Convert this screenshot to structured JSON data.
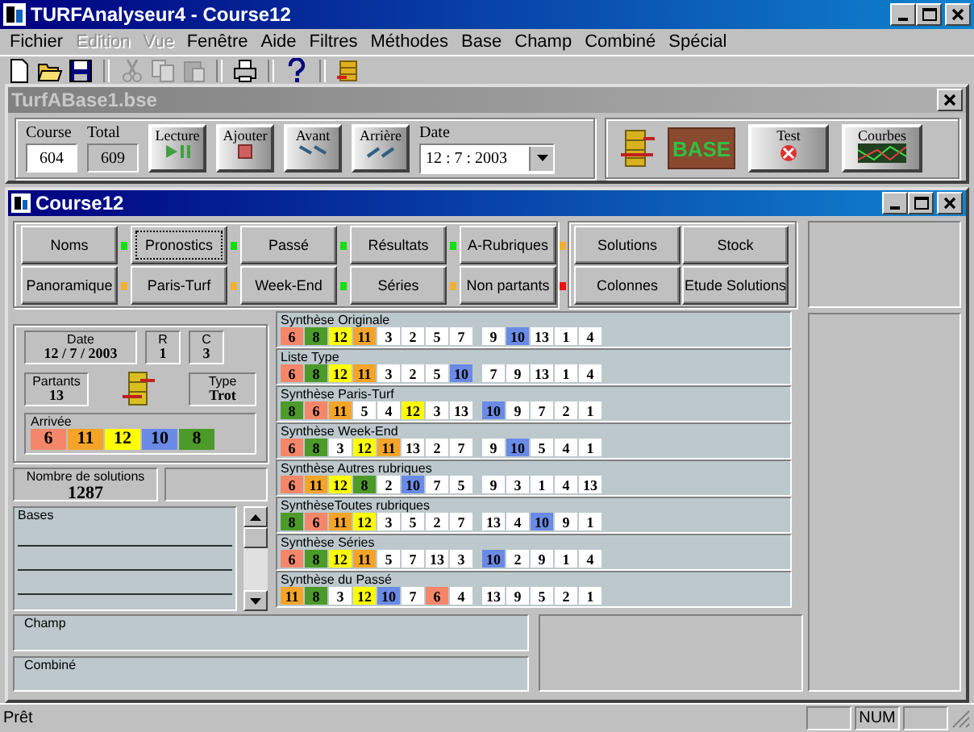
{
  "app_window": {
    "title": "TURFAnalyseur4 - Course12"
  },
  "menu": [
    {
      "label": "Fichier",
      "disabled": false
    },
    {
      "label": "Edition",
      "disabled": true
    },
    {
      "label": "Vue",
      "disabled": true
    },
    {
      "label": "Fenêtre",
      "disabled": false
    },
    {
      "label": "Aide",
      "disabled": false
    },
    {
      "label": "Filtres",
      "disabled": false
    },
    {
      "label": "Méthodes",
      "disabled": false
    },
    {
      "label": "Base",
      "disabled": false
    },
    {
      "label": "Champ",
      "disabled": false
    },
    {
      "label": "Combiné",
      "disabled": false
    },
    {
      "label": "Spécial",
      "disabled": false
    }
  ],
  "toolbar_groups": [
    [
      {
        "kind": "new",
        "disabled": false
      },
      {
        "kind": "open",
        "disabled": false
      },
      {
        "kind": "save",
        "disabled": false
      }
    ],
    [
      {
        "kind": "cut",
        "disabled": true
      },
      {
        "kind": "copy",
        "disabled": true
      },
      {
        "kind": "paste",
        "disabled": true
      }
    ],
    [
      {
        "kind": "print",
        "disabled": false
      }
    ],
    [
      {
        "kind": "help",
        "disabled": false
      }
    ],
    [
      {
        "kind": "database",
        "disabled": false
      }
    ]
  ],
  "base_window": {
    "title": "TurfABase1.bse",
    "course_label": "Course",
    "course_value": "604",
    "total_label": "Total",
    "total_value": "609",
    "buttons": [
      {
        "label": "Lecture",
        "kind": "play"
      },
      {
        "label": "Ajouter",
        "kind": "add"
      },
      {
        "label": "Avant",
        "kind": "forward"
      },
      {
        "label": "Arrière",
        "kind": "back"
      }
    ],
    "date_label": "Date",
    "date_value": "12 : 7 : 2003",
    "base_logo": "BASE",
    "test_label": "Test",
    "curves_label": "Courbes"
  },
  "course_window": {
    "title": "Course12",
    "nav_buttons": [
      {
        "label": "Noms",
        "color": "#10e010",
        "focused": false
      },
      {
        "label": "Pronostics",
        "color": "#10e010",
        "focused": true
      },
      {
        "label": "Passé",
        "color": "#10e010",
        "focused": false
      },
      {
        "label": "Résultats",
        "color": "#10e010",
        "focused": false
      },
      {
        "label": "A-Rubriques",
        "color": "#f0b030",
        "focused": false
      },
      {
        "label": "Panoramique",
        "color": "#f0b030",
        "focused": false
      },
      {
        "label": "Paris-Turf",
        "color": "#f0b030",
        "focused": false
      },
      {
        "label": "Week-End",
        "color": "#10e010",
        "focused": false
      },
      {
        "label": "Séries",
        "color": "#f0b030",
        "focused": false
      },
      {
        "label": "Non partants",
        "color": "#f01010",
        "focused": false
      }
    ],
    "side_buttons": [
      "Solutions",
      "Stock",
      "Colonnes",
      "Etude Solutions"
    ],
    "info": {
      "date_label": "Date",
      "date_value": "12 / 7 / 2003",
      "r_label": "R",
      "r_value": "1",
      "c_label": "C",
      "c_value": "3",
      "partants_label": "Partants",
      "partants_value": "13",
      "type_label": "Type",
      "type_value": "Trot"
    },
    "arrivee": {
      "label": "Arrivée",
      "cells": [
        {
          "v": "6",
          "color": "#f4866a"
        },
        {
          "v": "11",
          "color": "#f4a428"
        },
        {
          "v": "12",
          "color": "#ffff00"
        },
        {
          "v": "10",
          "color": "#6a8ae6"
        },
        {
          "v": "8",
          "color": "#4c9a2a"
        }
      ]
    },
    "solutions": {
      "label": "Nombre de solutions",
      "value": "1287"
    },
    "bases_label": "Bases",
    "syntheses": [
      {
        "label": "Synthèse Originale",
        "cells": [
          {
            "v": "6",
            "color": "#f4866a"
          },
          {
            "v": "8",
            "color": "#4c9a2a"
          },
          {
            "v": "12",
            "color": "#ffff00"
          },
          {
            "v": "11",
            "color": "#f4a428"
          },
          {
            "v": "3"
          },
          {
            "v": "2"
          },
          {
            "v": "5"
          },
          {
            "v": "7"
          },
          {
            "v": "9"
          },
          {
            "v": "10",
            "color": "#6a8ae6"
          },
          {
            "v": "13"
          },
          {
            "v": "1"
          },
          {
            "v": "4"
          }
        ]
      },
      {
        "label": "Liste Type",
        "cells": [
          {
            "v": "6",
            "color": "#f4866a"
          },
          {
            "v": "8",
            "color": "#4c9a2a"
          },
          {
            "v": "12",
            "color": "#ffff00"
          },
          {
            "v": "11",
            "color": "#f4a428"
          },
          {
            "v": "3"
          },
          {
            "v": "2"
          },
          {
            "v": "5"
          },
          {
            "v": "10",
            "color": "#6a8ae6"
          },
          {
            "v": "7"
          },
          {
            "v": "9"
          },
          {
            "v": "13"
          },
          {
            "v": "1"
          },
          {
            "v": "4"
          }
        ]
      },
      {
        "label": "Synthèse Paris-Turf",
        "cells": [
          {
            "v": "8",
            "color": "#4c9a2a"
          },
          {
            "v": "6",
            "color": "#f4866a"
          },
          {
            "v": "11",
            "color": "#f4a428"
          },
          {
            "v": "5"
          },
          {
            "v": "4"
          },
          {
            "v": "12",
            "color": "#ffff00"
          },
          {
            "v": "3"
          },
          {
            "v": "13"
          },
          {
            "v": "10",
            "color": "#6a8ae6"
          },
          {
            "v": "9"
          },
          {
            "v": "7"
          },
          {
            "v": "2"
          },
          {
            "v": "1"
          }
        ]
      },
      {
        "label": "Synthèse Week-End",
        "cells": [
          {
            "v": "6",
            "color": "#f4866a"
          },
          {
            "v": "8",
            "color": "#4c9a2a"
          },
          {
            "v": "3"
          },
          {
            "v": "12",
            "color": "#ffff00"
          },
          {
            "v": "11",
            "color": "#f4a428"
          },
          {
            "v": "13"
          },
          {
            "v": "2"
          },
          {
            "v": "7"
          },
          {
            "v": "9"
          },
          {
            "v": "10",
            "color": "#6a8ae6"
          },
          {
            "v": "5"
          },
          {
            "v": "4"
          },
          {
            "v": "1"
          }
        ]
      },
      {
        "label": "Synthèse Autres rubriques",
        "cells": [
          {
            "v": "6",
            "color": "#f4866a"
          },
          {
            "v": "11",
            "color": "#f4a428"
          },
          {
            "v": "12",
            "color": "#ffff00"
          },
          {
            "v": "8",
            "color": "#4c9a2a"
          },
          {
            "v": "2"
          },
          {
            "v": "10",
            "color": "#6a8ae6"
          },
          {
            "v": "7"
          },
          {
            "v": "5"
          },
          {
            "v": "9"
          },
          {
            "v": "3"
          },
          {
            "v": "1"
          },
          {
            "v": "4"
          },
          {
            "v": "13"
          }
        ]
      },
      {
        "label": "SynthèseToutes rubriques",
        "cells": [
          {
            "v": "8",
            "color": "#4c9a2a"
          },
          {
            "v": "6",
            "color": "#f4866a"
          },
          {
            "v": "11",
            "color": "#f4a428"
          },
          {
            "v": "12",
            "color": "#ffff00"
          },
          {
            "v": "3"
          },
          {
            "v": "5"
          },
          {
            "v": "2"
          },
          {
            "v": "7"
          },
          {
            "v": "13"
          },
          {
            "v": "4"
          },
          {
            "v": "10",
            "color": "#6a8ae6"
          },
          {
            "v": "9"
          },
          {
            "v": "1"
          }
        ]
      },
      {
        "label": "Synthèse Séries",
        "cells": [
          {
            "v": "6",
            "color": "#f4866a"
          },
          {
            "v": "8",
            "color": "#4c9a2a"
          },
          {
            "v": "12",
            "color": "#ffff00"
          },
          {
            "v": "11",
            "color": "#f4a428"
          },
          {
            "v": "5"
          },
          {
            "v": "7"
          },
          {
            "v": "13"
          },
          {
            "v": "3"
          },
          {
            "v": "10",
            "color": "#6a8ae6"
          },
          {
            "v": "2"
          },
          {
            "v": "9"
          },
          {
            "v": "1"
          },
          {
            "v": "4"
          }
        ]
      },
      {
        "label": "Synthèse du Passé",
        "cells": [
          {
            "v": "11",
            "color": "#f4a428"
          },
          {
            "v": "8",
            "color": "#4c9a2a"
          },
          {
            "v": "3"
          },
          {
            "v": "12",
            "color": "#ffff00"
          },
          {
            "v": "10",
            "color": "#6a8ae6"
          },
          {
            "v": "7"
          },
          {
            "v": "6",
            "color": "#f4866a"
          },
          {
            "v": "4"
          },
          {
            "v": "13"
          },
          {
            "v": "9"
          },
          {
            "v": "5"
          },
          {
            "v": "2"
          },
          {
            "v": "1"
          }
        ]
      }
    ],
    "champ_label": "Champ",
    "combine_label": "Combiné"
  },
  "status_bar": {
    "text": "Prêt",
    "indicator": "NUM"
  }
}
